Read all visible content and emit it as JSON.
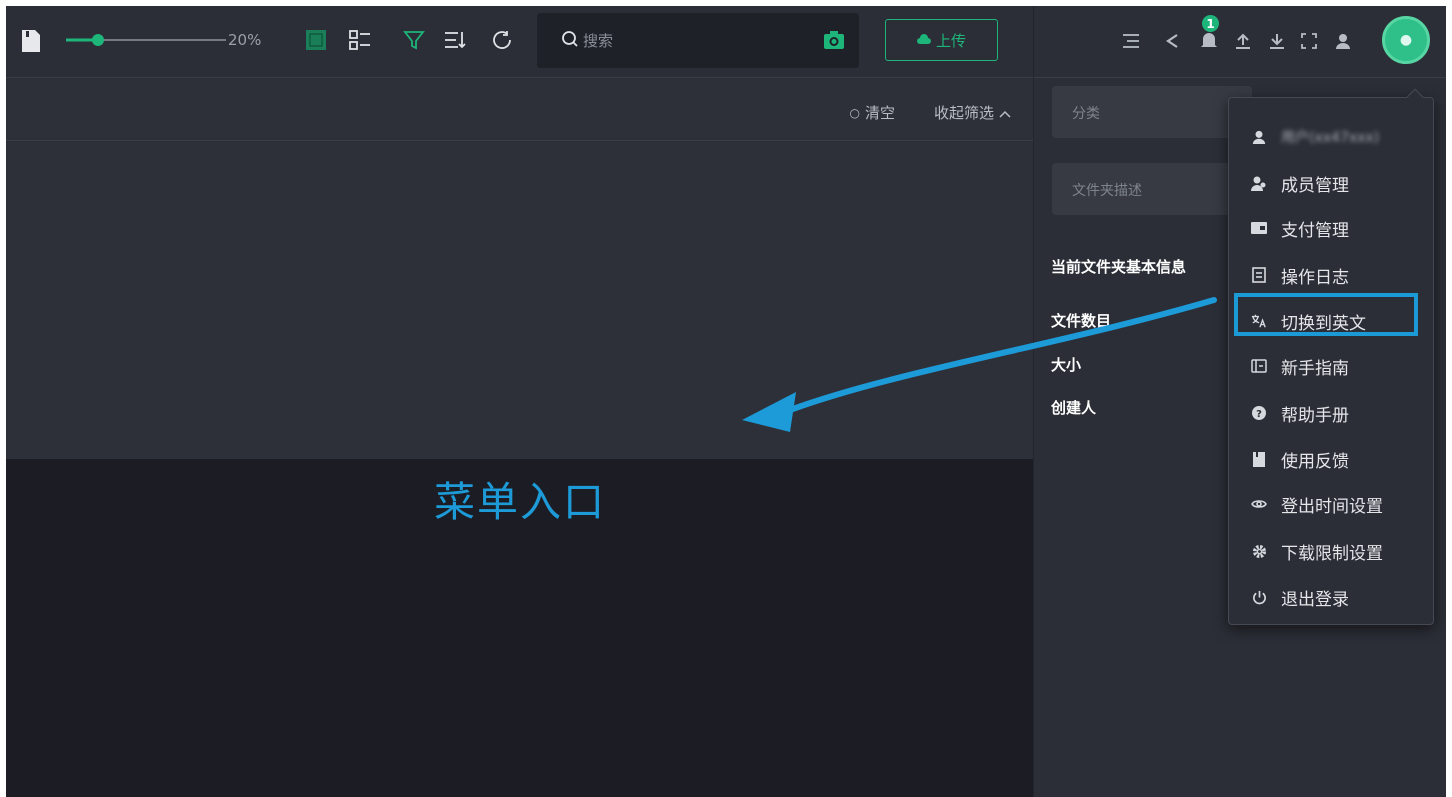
{
  "toolbar": {
    "zoom_label": "20%",
    "zoom_value": 0.2,
    "search_placeholder": "搜索",
    "upload_label": "上传"
  },
  "filter_bar": {
    "clear_label": "清空",
    "collapse_label": "收起筛选"
  },
  "right_header": {
    "notification_count": "1"
  },
  "details": {
    "category_placeholder": "分类",
    "folder_desc_placeholder": "文件夹描述",
    "section_title": "当前文件夹基本信息",
    "fields": [
      {
        "label": "文件数目"
      },
      {
        "label": "大小"
      },
      {
        "label": "创建人"
      }
    ]
  },
  "user_menu": {
    "user_label": "用户(xx47xxx)",
    "items": [
      {
        "label": "成员管理",
        "icon": "members-icon"
      },
      {
        "label": "支付管理",
        "icon": "wallet-icon"
      },
      {
        "label": "操作日志",
        "icon": "log-icon"
      },
      {
        "label": "切换到英文",
        "icon": "language-icon"
      },
      {
        "label": "新手指南",
        "icon": "guide-icon"
      },
      {
        "label": "帮助手册",
        "icon": "help-icon"
      },
      {
        "label": "使用反馈",
        "icon": "feedback-icon"
      },
      {
        "label": "登出时间设置",
        "icon": "eye-icon"
      },
      {
        "label": "下载限制设置",
        "icon": "gear-icon"
      },
      {
        "label": "退出登录",
        "icon": "power-icon"
      }
    ]
  },
  "annotation": {
    "text": "菜单入口"
  },
  "colors": {
    "accent": "#1eb57a",
    "annotation": "#1d9bd8",
    "background": "#2b2e36",
    "dark_area": "#1c1d24"
  }
}
